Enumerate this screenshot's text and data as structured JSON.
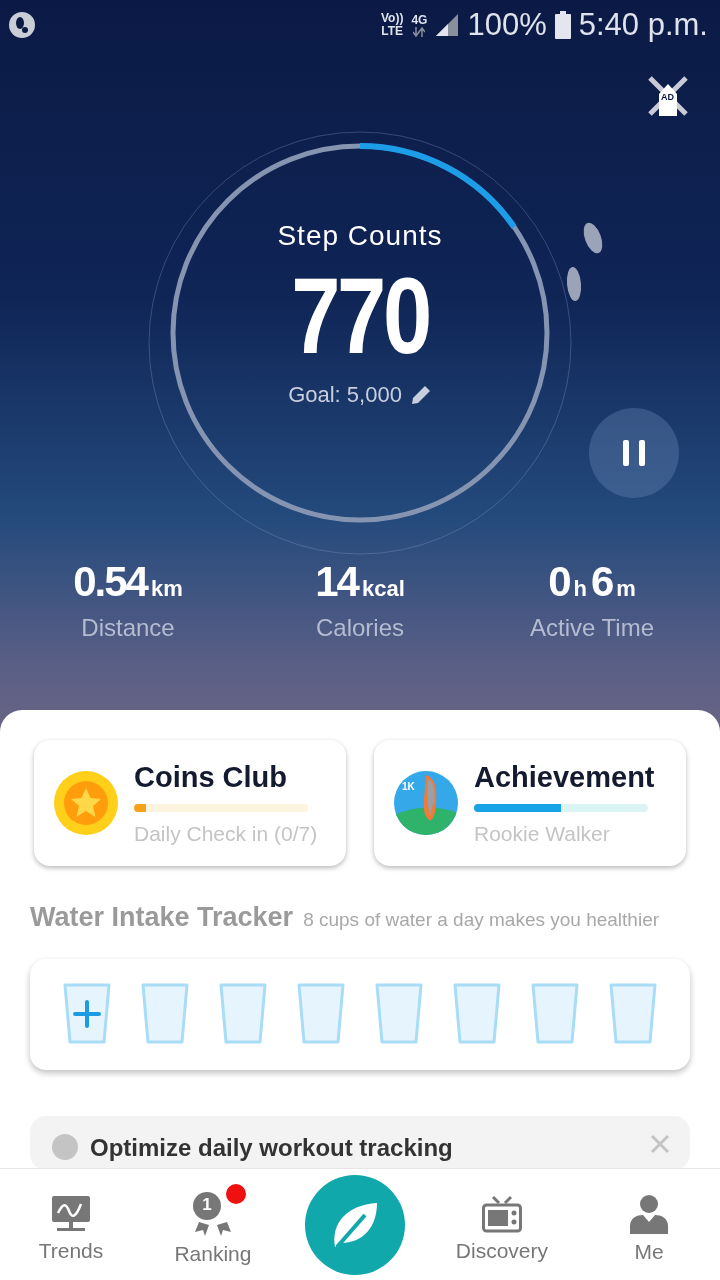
{
  "status_bar": {
    "volte": "Vo))",
    "volte_sub": "LTE",
    "network": "4G",
    "battery": "100%",
    "time": "5:40 p.m."
  },
  "ad": {
    "label": "AD"
  },
  "steps": {
    "title": "Step Counts",
    "count": "770",
    "goal": "Goal: 5,000",
    "level": 0.154
  },
  "stats": [
    {
      "value": "0.54",
      "unit": "km",
      "label": "Distance"
    },
    {
      "value": "14",
      "unit": "kcal",
      "label": "Calories"
    },
    {
      "value": "0",
      "unit": "h",
      "value2": "6",
      "unit2": "m",
      "label": "Active Time"
    }
  ],
  "cards": [
    {
      "kind": "coins",
      "title": "Coins Club",
      "subtitle": "Daily Check in (0/7)",
      "level": 0.07
    },
    {
      "kind": "achievement",
      "title": "Achievement",
      "subtitle": "Rookie Walker",
      "badge": "1K",
      "level": 0.5
    }
  ],
  "water": {
    "title": "Water Intake Tracker",
    "subtitle": "8 cups of water a day makes you healthier",
    "cups": [
      {
        "kind": "add"
      },
      {
        "kind": "empty"
      },
      {
        "kind": "empty"
      },
      {
        "kind": "empty"
      },
      {
        "kind": "empty"
      },
      {
        "kind": "empty"
      },
      {
        "kind": "empty"
      },
      {
        "kind": "empty"
      }
    ]
  },
  "tip": {
    "text": "Optimize daily workout tracking"
  },
  "nav": [
    {
      "kind": "trends",
      "label": "Trends"
    },
    {
      "kind": "ranking",
      "label": "Ranking",
      "medal": "1",
      "notification": true
    },
    {
      "kind": "home"
    },
    {
      "kind": "discovery",
      "label": "Discovery"
    },
    {
      "kind": "me",
      "label": "Me"
    }
  ]
}
